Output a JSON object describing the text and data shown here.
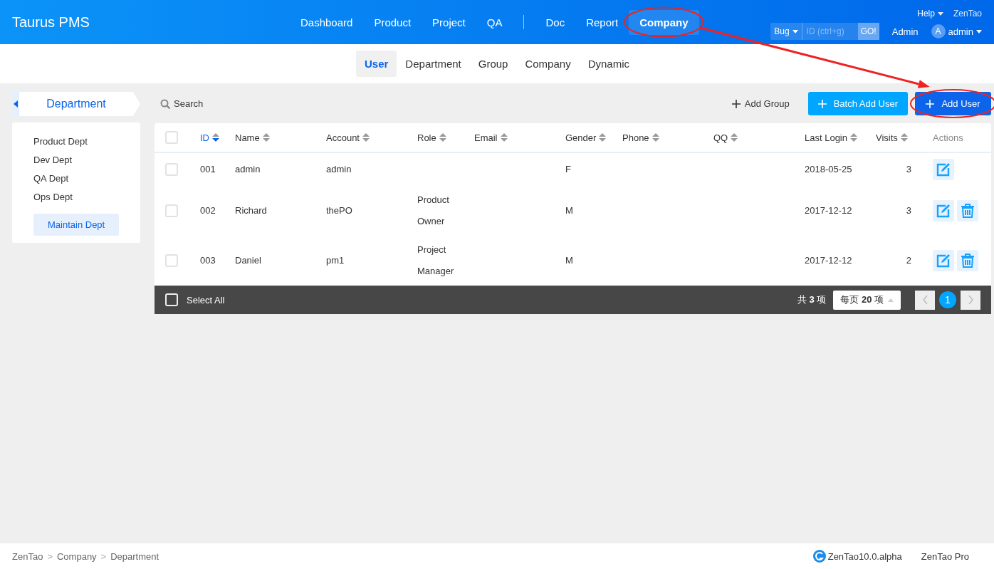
{
  "header": {
    "brand": "Taurus PMS",
    "nav_groups": [
      [
        {
          "label": "Dashboard",
          "selected": false,
          "circled": false
        },
        {
          "label": "Product",
          "selected": false,
          "circled": false
        },
        {
          "label": "Project",
          "selected": false,
          "circled": false
        },
        {
          "label": "QA",
          "selected": false,
          "circled": false
        }
      ],
      [
        {
          "label": "Doc",
          "selected": false,
          "circled": false
        },
        {
          "label": "Report",
          "selected": false,
          "circled": false
        },
        {
          "label": "Company",
          "selected": true,
          "circled": true
        }
      ]
    ],
    "help": "Help",
    "zentao": "ZenTao",
    "quick_search": {
      "type": "Bug",
      "placeholder": "ID (ctrl+g)",
      "button": "GO!"
    },
    "admin_link": "Admin",
    "user": {
      "avatar": "A",
      "name": "admin"
    }
  },
  "subnav": [
    {
      "label": "User",
      "selected": true
    },
    {
      "label": "Department",
      "selected": false
    },
    {
      "label": "Group",
      "selected": false
    },
    {
      "label": "Company",
      "selected": false
    },
    {
      "label": "Dynamic",
      "selected": false
    }
  ],
  "sidebar": {
    "title": "Department",
    "items": [
      "Product Dept",
      "Dev Dept",
      "QA Dept",
      "Ops Dept"
    ],
    "button": "Maintain Dept"
  },
  "toolbar": {
    "search": "Search",
    "add_group": "Add Group",
    "batch_add": {
      "label": "Batch Add User",
      "circled": false
    },
    "add_user": {
      "label": "Add User",
      "circled": true
    }
  },
  "table": {
    "header_checked": false,
    "columns": [
      {
        "label": "ID",
        "sortable": true,
        "sorted": true
      },
      {
        "label": "Name",
        "sortable": true,
        "sorted": false
      },
      {
        "label": "Account",
        "sortable": true,
        "sorted": false
      },
      {
        "label": "Role",
        "sortable": true,
        "sorted": false
      },
      {
        "label": "Email",
        "sortable": true,
        "sorted": false
      },
      {
        "label": "Gender",
        "sortable": true,
        "sorted": false
      },
      {
        "label": "Phone",
        "sortable": true,
        "sorted": false
      },
      {
        "label": "QQ",
        "sortable": true,
        "sorted": false
      },
      {
        "label": "Last Login",
        "sortable": true,
        "sorted": false
      },
      {
        "label": "Visits",
        "sortable": true,
        "sorted": false
      },
      {
        "label": "Actions",
        "sortable": false,
        "sorted": false
      }
    ],
    "rows": [
      {
        "checked": false,
        "cells": [
          "001",
          "admin",
          "admin",
          "",
          "",
          "F",
          "",
          "",
          "2018-05-25",
          "3"
        ],
        "actions": [
          {
            "kind": "edit"
          }
        ]
      },
      {
        "checked": false,
        "cells": [
          "002",
          "Richard",
          "thePO",
          "Product Owner",
          "",
          "M",
          "",
          "",
          "2017-12-12",
          "3"
        ],
        "actions": [
          {
            "kind": "edit"
          },
          {
            "kind": "delete"
          }
        ]
      },
      {
        "checked": false,
        "cells": [
          "003",
          "Daniel",
          "pm1",
          "Project Manager",
          "",
          "M",
          "",
          "",
          "2017-12-12",
          "2"
        ],
        "actions": [
          {
            "kind": "edit"
          },
          {
            "kind": "delete"
          }
        ]
      }
    ]
  },
  "table_footer": {
    "select_all": {
      "label": "Select All",
      "checked": false
    },
    "total": "共 **3** 项",
    "per_page": "每页 **20** 项",
    "pages": [
      {
        "label": "1",
        "selected": true
      }
    ]
  },
  "footer": {
    "breadcrumb": [
      {
        "kind": "link",
        "label": "ZenTao"
      },
      {
        "kind": "sep",
        "label": ">"
      },
      {
        "kind": "link",
        "label": "Company"
      },
      {
        "kind": "sep",
        "label": ">"
      },
      {
        "kind": "link",
        "label": "Department"
      }
    ],
    "version": "ZenTao10.0.alpha",
    "edition": "ZenTao Pro"
  }
}
